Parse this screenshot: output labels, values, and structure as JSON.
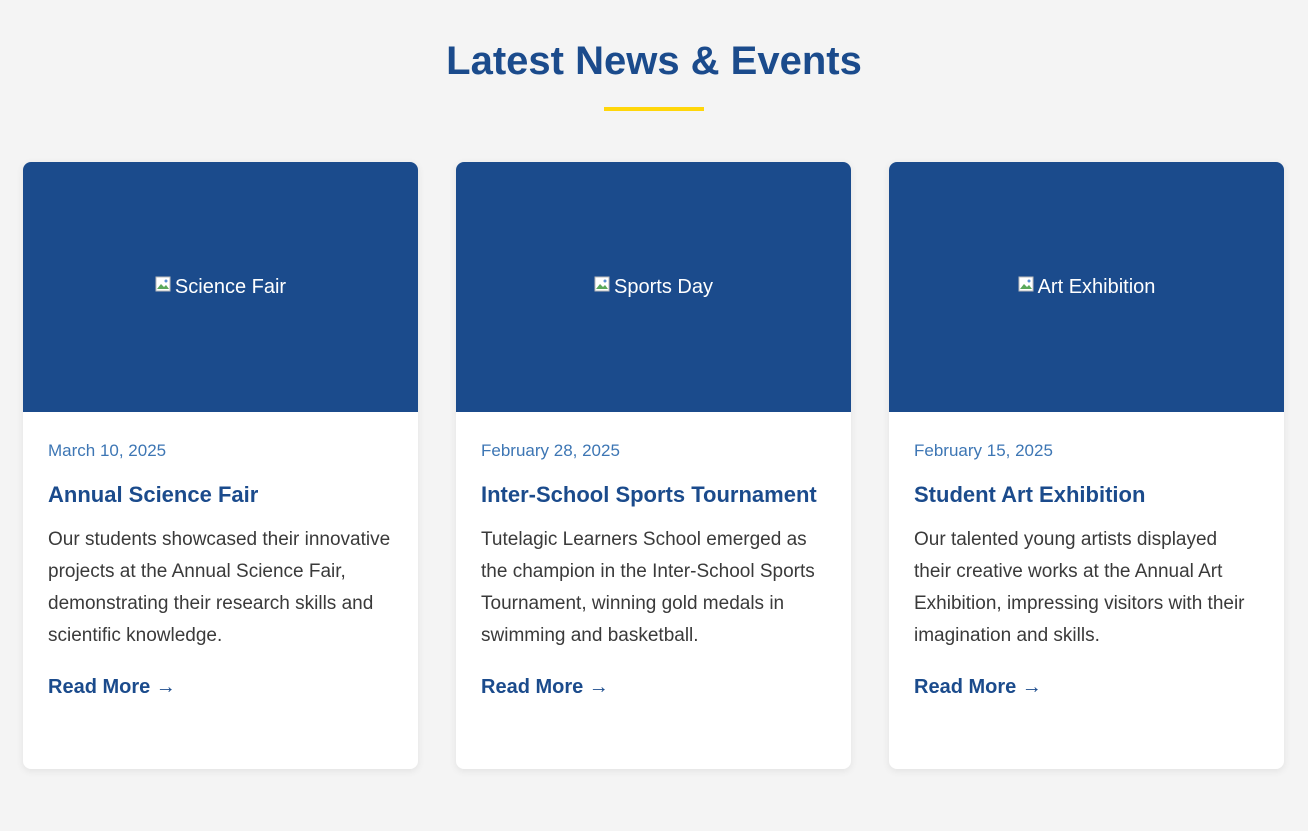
{
  "section": {
    "title": "Latest News & Events",
    "accent_color": "#ffd60a",
    "brand_color": "#1b4b8c"
  },
  "cards": [
    {
      "image_alt": "Science Fair",
      "date": "March 10, 2025",
      "title": "Annual Science Fair",
      "description": "Our students showcased their innovative projects at the Annual Science Fair, demonstrating their research skills and scientific knowledge.",
      "link_label": "Read More →"
    },
    {
      "image_alt": "Sports Day",
      "date": "February 28, 2025",
      "title": "Inter-School Sports Tournament",
      "description": "Tutelagic Learners School emerged as the champion in the Inter-School Sports Tournament, winning gold medals in swimming and basketball.",
      "link_label": "Read More →"
    },
    {
      "image_alt": "Art Exhibition",
      "date": "February 15, 2025",
      "title": "Student Art Exhibition",
      "description": "Our talented young artists displayed their creative works at the Annual Art Exhibition, impressing visitors with their imagination and skills.",
      "link_label": "Read More →"
    }
  ]
}
